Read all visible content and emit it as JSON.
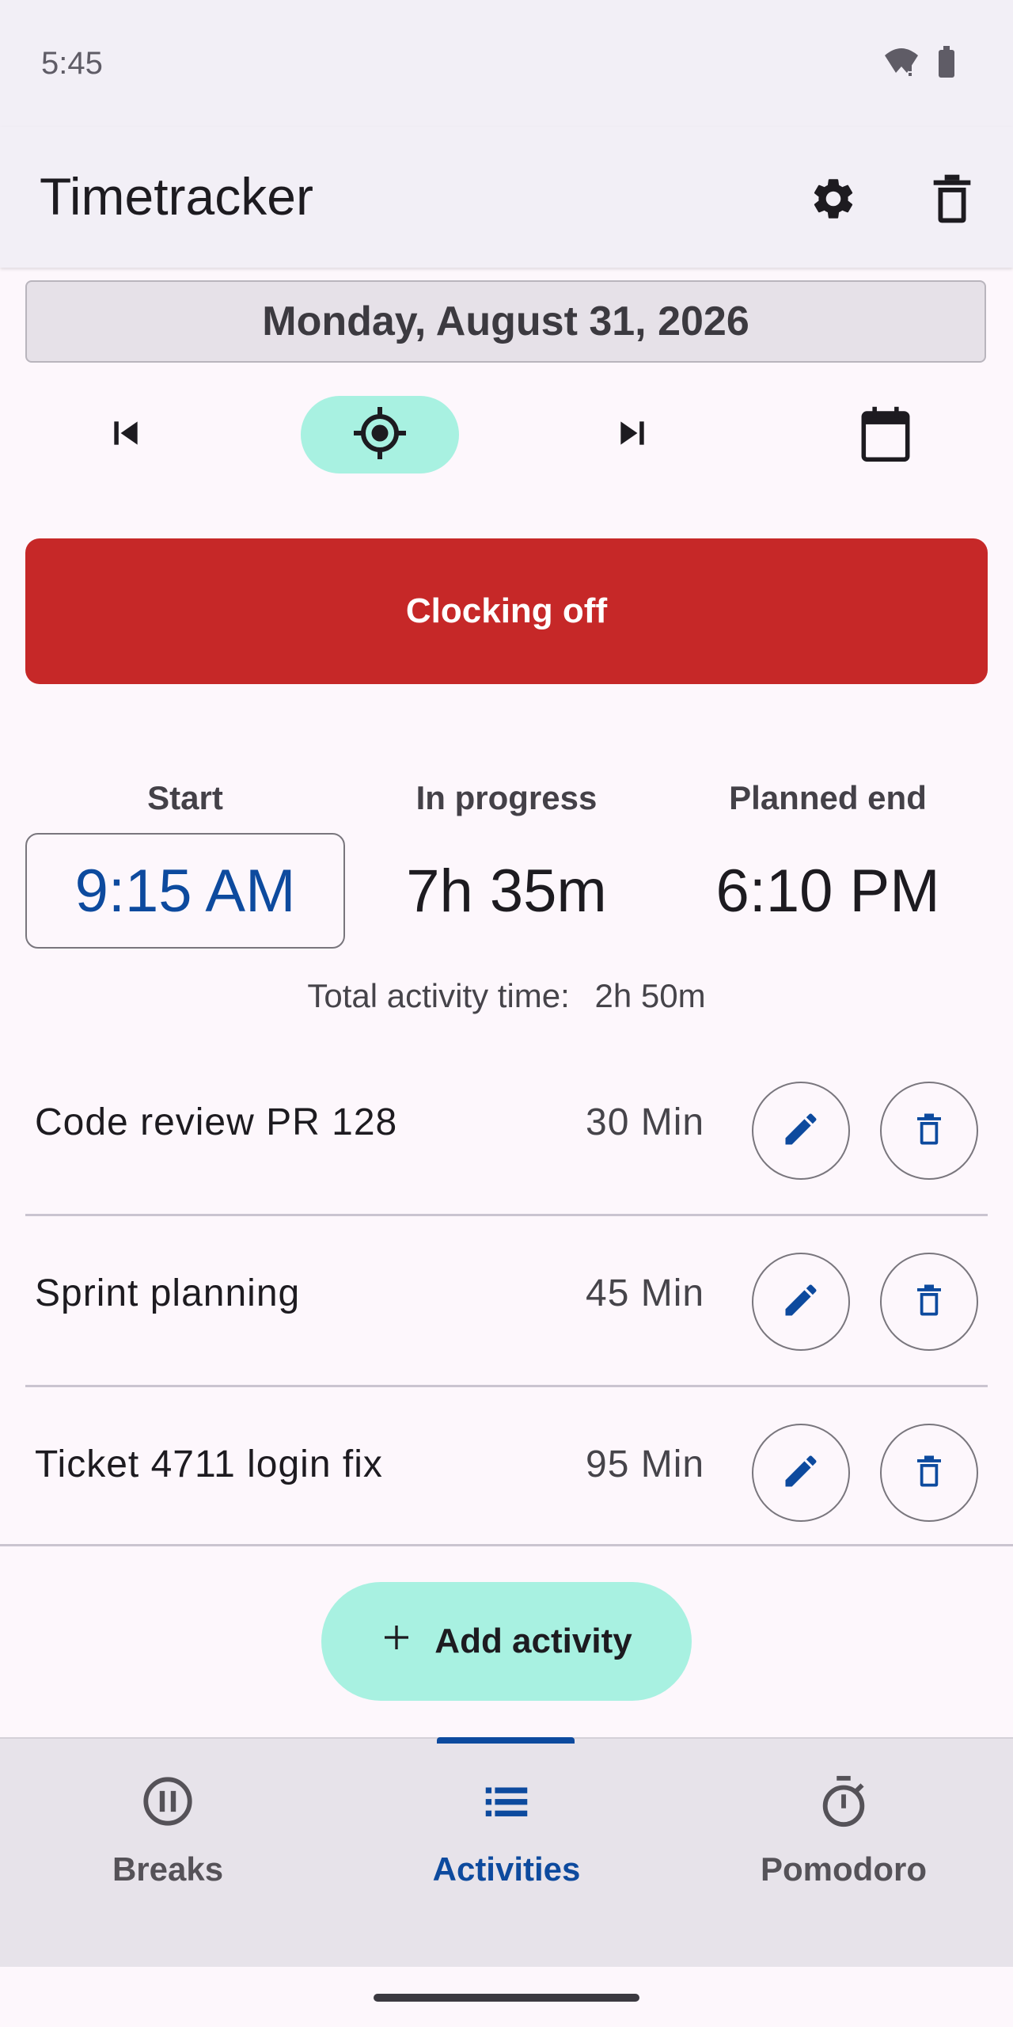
{
  "status": {
    "time": "5:45"
  },
  "appbar": {
    "title": "Timetracker",
    "settings_icon": "gear-icon",
    "delete_icon": "trash-icon"
  },
  "date": {
    "label": "Monday, August 31, 2026"
  },
  "nav": {
    "prev_icon": "skip-previous-icon",
    "today_icon": "target-icon",
    "next_icon": "skip-next-icon",
    "calendar_icon": "calendar-icon"
  },
  "clock": {
    "button_label": "Clocking off",
    "button_color": "#c62828"
  },
  "stats": {
    "start_label": "Start",
    "start_value": "9:15 AM",
    "progress_label": "In progress",
    "progress_value": "7h 35m",
    "end_label": "Planned end",
    "end_value": "6:10 PM",
    "total_label": "Total activity time:",
    "total_value": "2h 50m"
  },
  "activities": [
    {
      "name": "Code review PR 128",
      "duration": "30 Min"
    },
    {
      "name": "Sprint planning",
      "duration": "45 Min"
    },
    {
      "name": "Ticket 4711 login fix",
      "duration": "95 Min"
    }
  ],
  "add_button": {
    "label": "Add activity"
  },
  "bottom_nav": {
    "tabs": [
      {
        "label": "Breaks",
        "icon": "pause-circle-icon"
      },
      {
        "label": "Activities",
        "icon": "list-icon"
      },
      {
        "label": "Pomodoro",
        "icon": "timer-icon"
      }
    ],
    "selected": "Activities",
    "accent": "#0d4a9e"
  },
  "colors": {
    "accent": "#0d4a9e",
    "teal": "#a8f1e1",
    "danger": "#c62828"
  }
}
